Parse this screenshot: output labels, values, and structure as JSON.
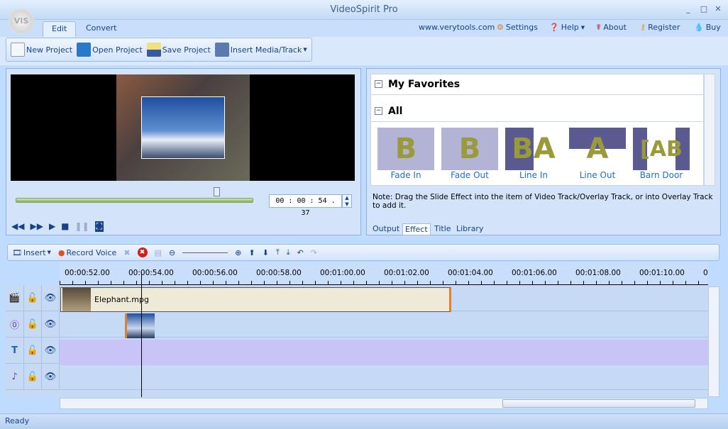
{
  "app": {
    "title": "VideoSpirit Pro",
    "logo": "VIS"
  },
  "tabs": [
    {
      "label": "Edit",
      "active": true
    },
    {
      "label": "Convert",
      "active": false
    }
  ],
  "toplinks": {
    "site": "www.verytools.com",
    "settings": "Settings",
    "help": "Help",
    "about": "About",
    "register": "Register",
    "buy": "Buy"
  },
  "toolbar": {
    "new": "New Project",
    "open": "Open Project",
    "save": "Save Project",
    "insert": "Insert Media/Track"
  },
  "preview": {
    "time": "00 : 00 : 54 . 37",
    "progress": 0.86
  },
  "effects": {
    "favorites": "My Favorites",
    "all": "All",
    "items": [
      {
        "label": "Fade In",
        "glyph": "B"
      },
      {
        "label": "Fade Out",
        "glyph": "B"
      },
      {
        "label": "Line In",
        "glyph": "BA"
      },
      {
        "label": "Line Out",
        "glyph": "A"
      },
      {
        "label": "Barn Door",
        "glyph": "[AB"
      }
    ],
    "note": "Note: Drag the Slide Effect into the item of Video Track/Overlay Track, or into Overlay Track to add it.",
    "tabs": [
      "Output",
      "Effect",
      "Title",
      "Library"
    ],
    "active_tab": "Effect"
  },
  "timeline": {
    "insert": "Insert",
    "record": "Record Voice",
    "ticks": [
      "00:00:52.00",
      "00:00:54.00",
      "00:00:56.00",
      "00:00:58.00",
      "00:01:00.00",
      "00:01:02.00",
      "00:01:04.00",
      "00:01:06.00",
      "00:01:08.00",
      "00:01:10.00",
      "0"
    ],
    "clip": "Elephant.mpg",
    "tracks": [
      {
        "icon": "clapper-icon"
      },
      {
        "icon": "overlay-icon"
      },
      {
        "icon": "text-icon"
      },
      {
        "icon": "music-icon"
      }
    ]
  },
  "status": "Ready"
}
